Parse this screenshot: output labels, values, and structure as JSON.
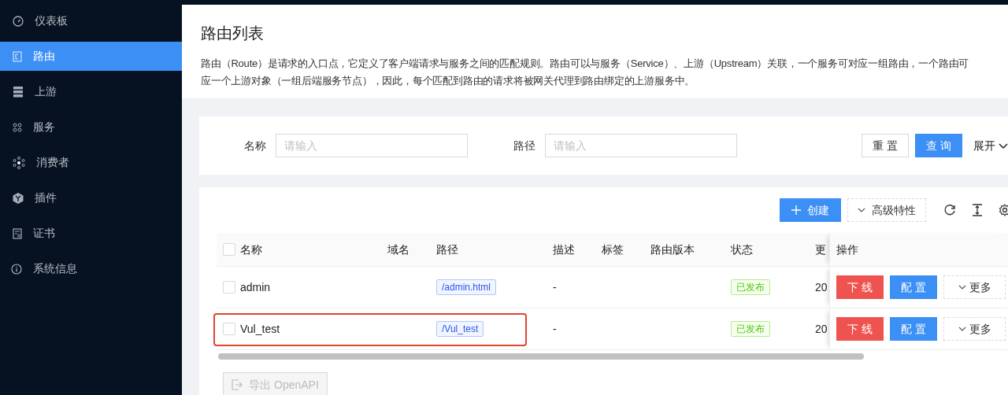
{
  "sidebar": {
    "items": [
      {
        "label": "仪表板",
        "selected": false
      },
      {
        "label": "路由",
        "selected": true
      },
      {
        "label": "上游",
        "selected": false
      },
      {
        "label": "服务",
        "selected": false
      },
      {
        "label": "消费者",
        "selected": false
      },
      {
        "label": "插件",
        "selected": false
      },
      {
        "label": "证书",
        "selected": false
      },
      {
        "label": "系统信息",
        "selected": false
      }
    ]
  },
  "header": {
    "title": "路由列表",
    "description": [
      "路由（Route）是请求的入口点，它定义了客户端请求与服务之间的匹配规则。路由可以与服务（Service）、上游（Upstream）关联，一个服务可对应一组路由，一个路由可",
      "应一个上游对象（一组后端服务节点），因此，每个匹配到路由的请求将被网关代理到路由绑定的上游服务中。"
    ]
  },
  "search": {
    "fields": [
      {
        "label": "名称",
        "placeholder": "请输入"
      },
      {
        "label": "路径",
        "placeholder": "请输入"
      }
    ],
    "reset": "重 置",
    "query": "查 询",
    "expand": "展开"
  },
  "toolbar": {
    "create": "创建",
    "advanced": "高级特性"
  },
  "table": {
    "all_checked": false,
    "columns": [
      "名称",
      "域名",
      "路径",
      "描述",
      "标签",
      "路由版本",
      "状态",
      "更",
      "操作"
    ],
    "rows": [
      {
        "checked": false,
        "name": "admin",
        "path": "/admin.html",
        "desc": "-",
        "status": "已发布",
        "update": "20",
        "highlighted": false,
        "actions": [
          "下 线",
          "配 置",
          "更多"
        ]
      },
      {
        "checked": false,
        "name": "Vul_test",
        "path": "/Vul_test",
        "desc": "-",
        "status": "已发布",
        "update": "20",
        "highlighted": true,
        "actions": [
          "下 线",
          "配 置",
          "更多"
        ]
      }
    ]
  },
  "export": "导出 OpenAPI"
}
